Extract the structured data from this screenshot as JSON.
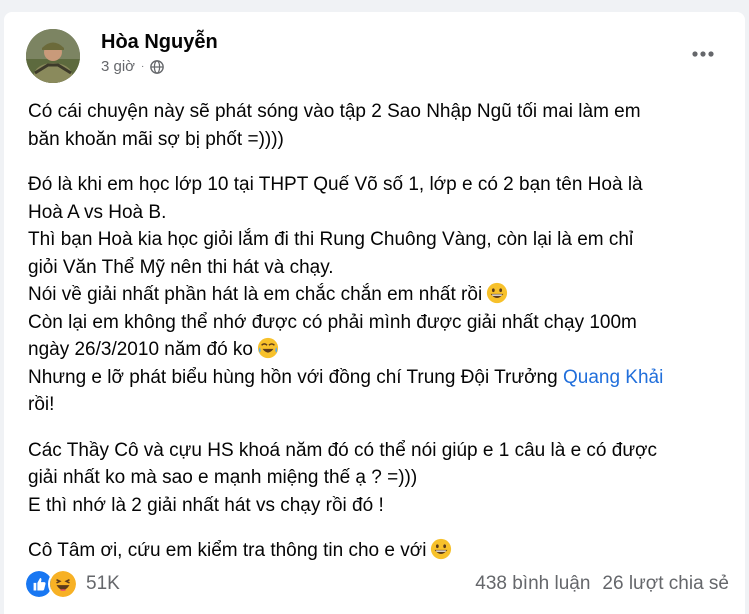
{
  "post": {
    "author": "Hòa Nguyễn",
    "timestamp": "3 giờ",
    "privacy_icon": "globe-icon",
    "more_icon": "more-horizontal-icon"
  },
  "content": {
    "paragraphs": [
      {
        "lines": [
          "Có cái chuyện này sẽ phát sóng vào tập 2 Sao Nhập Ngũ tối mai làm em",
          "băn khoăn mãi sợ bị phốt  =))))"
        ]
      },
      {
        "lines": [
          "Đó là khi em học lớp 10 tại THPT Quế Võ số 1, lớp e có 2 bạn tên Hoà là",
          "Hoà A vs Hoà B.",
          "Thì bạn Hoà kia học giỏi lắm đi thi Rung Chuông Vàng, còn lại là em chỉ",
          "giỏi Văn Thể Mỹ nên thi hát và chạy.",
          "Nói về giải nhất phần hát là em chắc chắn em nhất rồi",
          "Còn lại em không thể nhớ được có phải mình được giải nhất chạy 100m",
          "ngày 26/3/2010 năm đó ko",
          "Nhưng e lỡ phát biểu hùng hồn với đồng chí Trung Đội Trưởng",
          "rồi!"
        ],
        "mention": "Quang Khải"
      },
      {
        "lines": [
          "Các Thầy Cô và cựu HS khoá năm đó có thể nói giúp e 1 câu là e có được",
          "giải nhất ko mà sao e mạnh miệng thế ạ ? =)))",
          "E thì nhớ là 2 giải nhất hát vs chạy rồi đó !"
        ]
      },
      {
        "lines": [
          "Cô Tâm ơi, cứu em kiểm tra thông tin cho e với"
        ]
      }
    ],
    "emojis": [
      "grinning-face-icon",
      "tears-of-joy-face-icon",
      "grinning-face-icon"
    ]
  },
  "engagement": {
    "reaction_icons": [
      "like-reaction-icon",
      "haha-reaction-icon"
    ],
    "reaction_count": "51K",
    "comments": "438 bình luận",
    "shares": "26 lượt chia sẻ"
  },
  "colors": {
    "link": "#216fdb",
    "meta": "#65676b",
    "like": "#1877f2",
    "haha": "#f7b125"
  }
}
